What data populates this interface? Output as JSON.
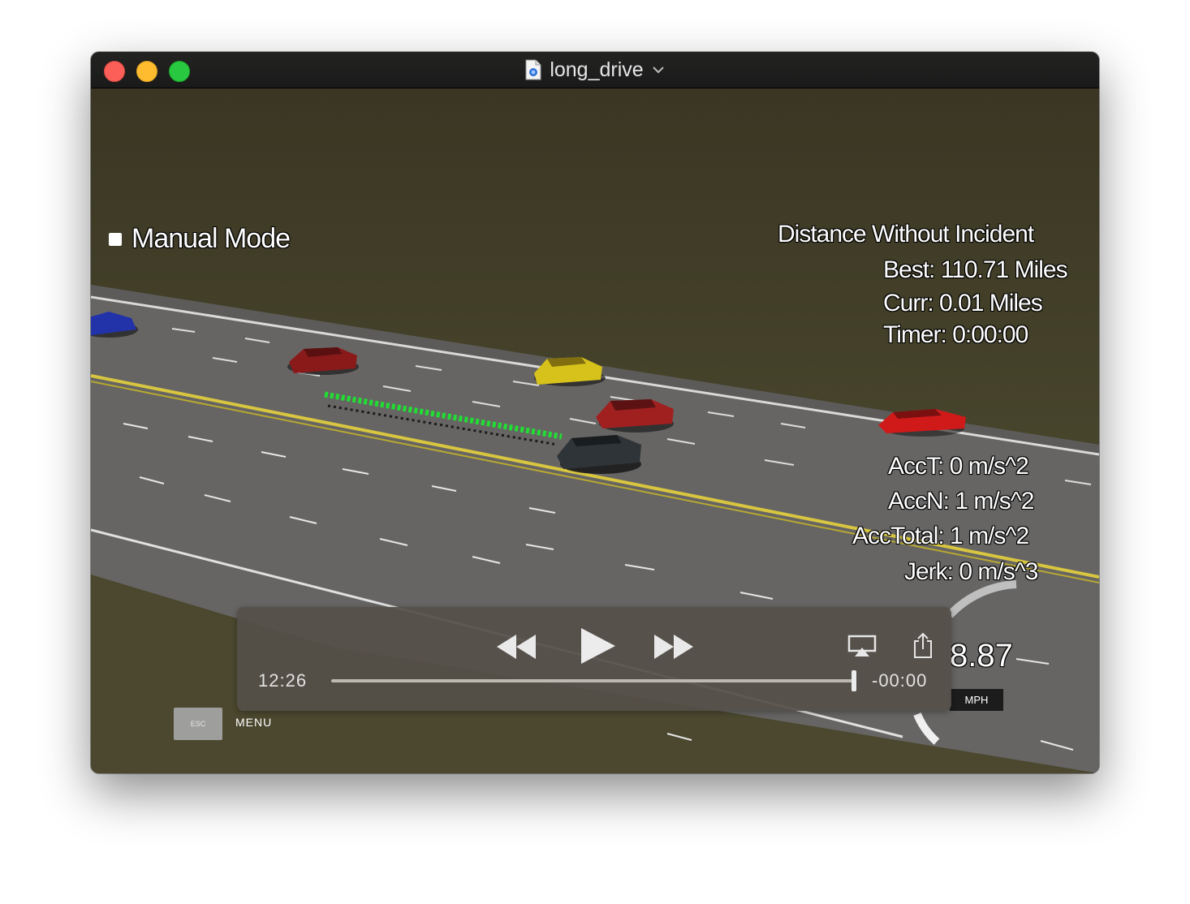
{
  "window": {
    "title": "long_drive"
  },
  "hud": {
    "mode_label": "Manual Mode",
    "distance_title": "Distance Without Incident",
    "best": "Best: 110.71 Miles",
    "curr": "Curr: 0.01 Miles",
    "timer": "Timer: 0:00:00",
    "acc_t": "AccT: 0 m/s^2",
    "acc_n": "AccN: 1 m/s^2",
    "acc_total": "AccTotal: 1 m/s^2",
    "jerk": "Jerk: 0 m/s^3",
    "speed": "8.87",
    "speed_unit": "MPH",
    "esc_key": "ESC",
    "menu_label": "MENU"
  },
  "player": {
    "elapsed": "12:26",
    "remaining": "-00:00",
    "progress": 0.99
  },
  "colors": {
    "trajectory": "#22dd33",
    "car_colors": [
      "#2233aa",
      "#8a1a1a",
      "#d6c21a",
      "#a02020",
      "#2f3438",
      "#d01a1a"
    ]
  },
  "icons": [
    "document-icon",
    "chevron-down-icon",
    "rewind-icon",
    "play-icon",
    "fast-forward-icon",
    "airplay-icon",
    "share-icon"
  ]
}
